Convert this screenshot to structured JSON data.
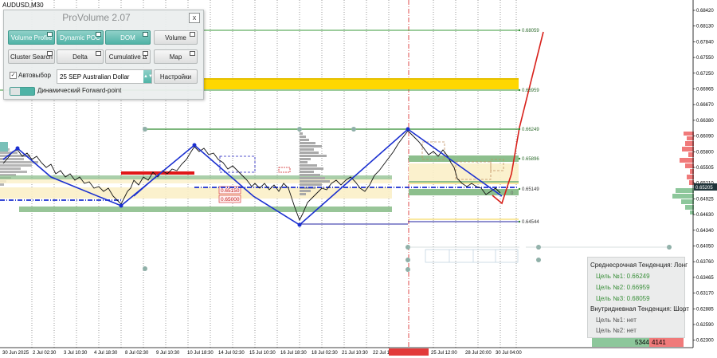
{
  "symbol_label": "AUDUSD,M30",
  "panel": {
    "title": "ProVolume 2.07",
    "close_label": "x",
    "buttons": {
      "volume_profile": "Volume Profile",
      "dynamic_poc": "Dynamic POC",
      "dom": "DOM",
      "volume": "Volume",
      "cluster_search": "Cluster Search",
      "delta": "Delta",
      "cumulative_delta": "Cumulative Δ",
      "map": "Map",
      "settings": "Настройки"
    },
    "autoselect_label": "Автовыбор",
    "autoselect_checked": "✓",
    "instrument_value": "25 SEP Australian Dollar",
    "forward_point_label": "Динамический Forward-point"
  },
  "price_axis": [
    "0.68420",
    "0.68130",
    "0.67840",
    "0.67550",
    "0.67250",
    "0.66965",
    "0.66670",
    "0.66380",
    "0.66090",
    "0.65800",
    "0.65505",
    "0.65210",
    "0.64925",
    "0.64630",
    "0.64340",
    "0.64050",
    "0.63760",
    "0.63465",
    "0.63170",
    "0.62885",
    "0.62590",
    "0.62300"
  ],
  "current_price": "0.65205",
  "time_axis": [
    "30 Jun 2025",
    "2 Jul 02:30",
    "3 Jul 10:30",
    "4 Jul 18:30",
    "8 Jul 02:30",
    "9 Jul 10:30",
    "10 Jul 18:30",
    "14 Jul 02:30",
    "15 Jul 10:30",
    "16 Jul 18:30",
    "18 Jul 02:30",
    "21 Jul 10:30",
    "22 Jul 18:30",
    "2025.07.24 08:30",
    "25 Jul 12:00",
    "28 Jul 20:00",
    "30 Jul 04:00"
  ],
  "level_labels": {
    "l1": "0.68059",
    "l2": "0.66959",
    "l3": "0.66249",
    "l4": "0.65896",
    "l5": "0.65149",
    "l6": "0.64544",
    "box1": "0.65150",
    "box2": "0.65000",
    "zero": "0"
  },
  "info_panel": {
    "medium_trend": "Среднесрочная Тенденция: Лонг",
    "target1": "Цель №1: 0.66249",
    "target2": "Цель №2: 0.66959",
    "target3": "Цель №3: 0.68059",
    "intraday_trend": "Внутридневная Тенденция: Шорт",
    "intraday_target1": "Цель №1: нет",
    "intraday_target2": "Цель №2: нет"
  },
  "volume_bar": {
    "buy": "5344",
    "sell": "4141"
  },
  "colors": {
    "teal_button": "#4fb3a6",
    "yellow_zone": "#ffd700",
    "zigzag": "#1a2fd0",
    "target_line": "#2e8b2e",
    "forecast": "#d8201a"
  }
}
